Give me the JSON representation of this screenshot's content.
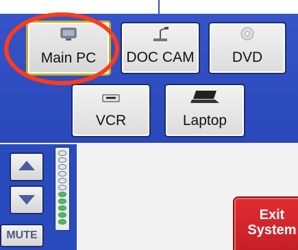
{
  "sources": {
    "main_pc": {
      "label": "Main PC",
      "icon": "monitor-icon",
      "selected": true
    },
    "doc_cam": {
      "label": "DOC CAM",
      "icon": "document-camera-icon",
      "selected": false
    },
    "dvd": {
      "label": "DVD",
      "icon": "disc-icon",
      "selected": false
    },
    "vcr": {
      "label": "VCR",
      "icon": "vcr-icon",
      "selected": false
    },
    "laptop": {
      "label": "Laptop",
      "icon": "laptop-icon",
      "selected": false
    }
  },
  "volume": {
    "up_icon": "up-arrow-icon",
    "down_icon": "down-arrow-icon",
    "mute_label": "MUTE",
    "level_fraction": 0.5
  },
  "exit": {
    "line1": "Exit",
    "line2": "System"
  },
  "colors": {
    "panel_blue": "#2a4bbd",
    "selected_border": "#c9b12a",
    "highlight_ring": "#ff3b1a",
    "exit_red": "#d0262d",
    "meter_green": "#39c94a"
  }
}
